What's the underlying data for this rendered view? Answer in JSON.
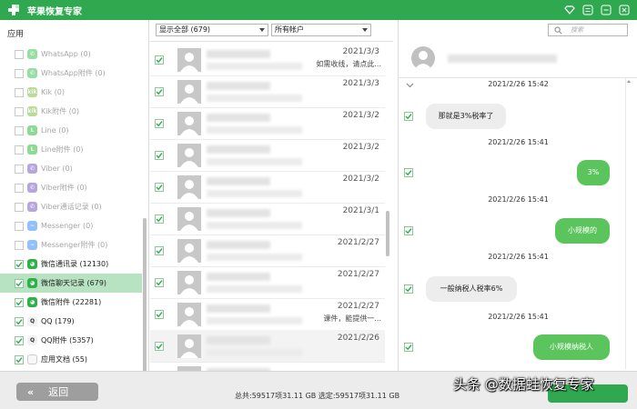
{
  "window": {
    "title": "苹果恢复专家",
    "accent": "#2fa84f",
    "controls": [
      "diamond-icon",
      "menu-icon",
      "minimize-icon",
      "close-icon"
    ]
  },
  "sidebar": {
    "header": "应用",
    "items": [
      {
        "label": "WhatsApp (0)",
        "checked": false,
        "icon": "whatsapp-icon"
      },
      {
        "label": "WhatsApp附件 (0)",
        "checked": false,
        "icon": "whatsapp-icon"
      },
      {
        "label": "Kik (0)",
        "checked": false,
        "icon": "kik-icon"
      },
      {
        "label": "Kik附件 (0)",
        "checked": false,
        "icon": "kik-icon"
      },
      {
        "label": "Line (0)",
        "checked": false,
        "icon": "line-icon"
      },
      {
        "label": "Line附件 (0)",
        "checked": false,
        "icon": "line-icon"
      },
      {
        "label": "Viber (0)",
        "checked": false,
        "icon": "viber-icon"
      },
      {
        "label": "Viber附件 (0)",
        "checked": false,
        "icon": "viber-icon"
      },
      {
        "label": "Viber通话记录 (0)",
        "checked": false,
        "icon": "viber-icon"
      },
      {
        "label": "Messenger (0)",
        "checked": false,
        "icon": "messenger-icon"
      },
      {
        "label": "Messenger附件 (0)",
        "checked": false,
        "icon": "messenger-icon"
      },
      {
        "label": "微信通讯录 (12130)",
        "checked": true,
        "icon": "wechat-icon"
      },
      {
        "label": "微信聊天记录 (679)",
        "checked": true,
        "icon": "wechat-icon",
        "selected": true
      },
      {
        "label": "微信附件 (22281)",
        "checked": true,
        "icon": "wechat-icon"
      },
      {
        "label": "QQ (179)",
        "checked": true,
        "icon": "qq-icon"
      },
      {
        "label": "QQ附件 (5357)",
        "checked": true,
        "icon": "qq-icon"
      },
      {
        "label": "应用文档 (55)",
        "checked": true,
        "icon": "document-icon"
      }
    ]
  },
  "list": {
    "filter_display": "显示全部 (679)",
    "filter_account": "所有帐户",
    "rows": [
      {
        "date": "2021/3/3",
        "snippet": "如需收线，请点此..."
      },
      {
        "date": "2021/3/3",
        "snippet": ""
      },
      {
        "date": "2021/3/2",
        "snippet": ""
      },
      {
        "date": "2021/3/2",
        "snippet": ""
      },
      {
        "date": "2021/3/2",
        "snippet": ""
      },
      {
        "date": "2021/3/1",
        "snippet": ""
      },
      {
        "date": "2021/2/27",
        "snippet": ""
      },
      {
        "date": "2021/2/27",
        "snippet": ""
      },
      {
        "date": "2021/2/27",
        "snippet": "课件，能提供一..."
      },
      {
        "date": "2021/2/26",
        "snippet": ""
      },
      {
        "date": "",
        "snippet": ""
      }
    ]
  },
  "chat": {
    "search_placeholder": "搜索",
    "messages": [
      {
        "time": "2021/2/26 15:42",
        "text": "那就是3%税率了",
        "dir": "in"
      },
      {
        "time": "2021/2/26 15:41",
        "text": "3%",
        "dir": "out"
      },
      {
        "time": "2021/2/26 15:41",
        "text": "小规模的",
        "dir": "out"
      },
      {
        "time": "2021/2/26 15:41",
        "text": "一般纳税人税率6%",
        "dir": "in"
      },
      {
        "time": "2021/2/26 15:41",
        "text": "小规模纳税人",
        "dir": "out"
      }
    ]
  },
  "footer": {
    "back_label": "返回",
    "status": "总共:59517项31.11 GB 选定:59517项31.11 GB",
    "watermark": "头条 @数据蛙恢复专家"
  }
}
